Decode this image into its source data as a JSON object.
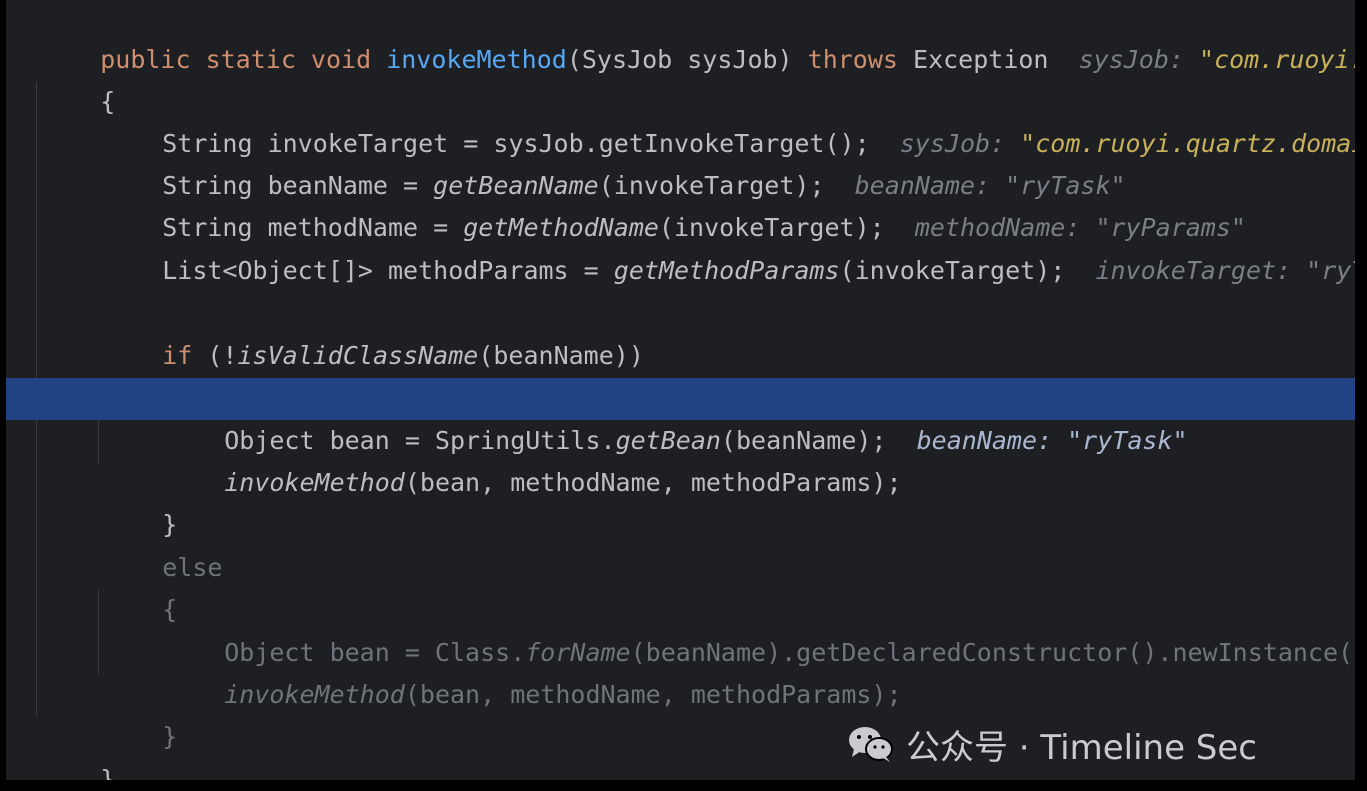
{
  "code": {
    "line1": {
      "kw": "public static void ",
      "name": "invokeMethod",
      "params": "(SysJob sysJob) ",
      "throws": "throws",
      "exc": " Exception",
      "hint_label": "sysJob: ",
      "hint_value": "\"com.ruoyi.q"
    },
    "line2": {
      "text": "{"
    },
    "line3": {
      "code": "String invokeTarget = sysJob.getInvokeTarget();",
      "hint_label": "sysJob: ",
      "hint_value": "\"com.ruoyi.quartz.domain"
    },
    "line4": {
      "pre": "String beanName = ",
      "call": "getBeanName",
      "post": "(invokeTarget);",
      "hint_label": "beanName: ",
      "hint_value": "\"ryTask\""
    },
    "line5": {
      "pre": "String methodName = ",
      "call": "getMethodName",
      "post": "(invokeTarget);",
      "hint_label": "methodName: ",
      "hint_value": "\"ryParams\""
    },
    "line6": {
      "pre": "List<Object[]> methodParams = ",
      "call": "getMethodParams",
      "post": "(invokeTarget);",
      "hint_label": "invokeTarget: ",
      "hint_value": "\"ryTa"
    },
    "line8": {
      "kw": "if",
      "pre": " (!",
      "call": "isValidClassName",
      "post": "(beanName))"
    },
    "line9": {
      "text": "{"
    },
    "line10": {
      "pre": "Object bean = SpringUtils.",
      "call": "getBean",
      "post": "(beanName);",
      "hint_label": "beanName: ",
      "hint_value": "\"ryTask\""
    },
    "line11": {
      "call": "invokeMethod",
      "post": "(bean, methodName, methodParams);"
    },
    "line12": {
      "text": "}"
    },
    "line13": {
      "text": "else"
    },
    "line14": {
      "text": "{"
    },
    "line15": {
      "pre": "Object bean = Class.",
      "call": "forName",
      "post": "(beanName).getDeclaredConstructor().newInstance();"
    },
    "line16": {
      "call": "invokeMethod",
      "post": "(bean, methodName, methodParams);"
    },
    "line17": {
      "text": "}"
    },
    "line18": {
      "text": "}"
    }
  },
  "watermark": {
    "icon": "wechat-icon",
    "text": "公众号 · Timeline Sec"
  },
  "colors": {
    "background": "#1e1f22",
    "keyword": "#cf8e6d",
    "function": "#56a8f5",
    "highlight": "#214283"
  }
}
